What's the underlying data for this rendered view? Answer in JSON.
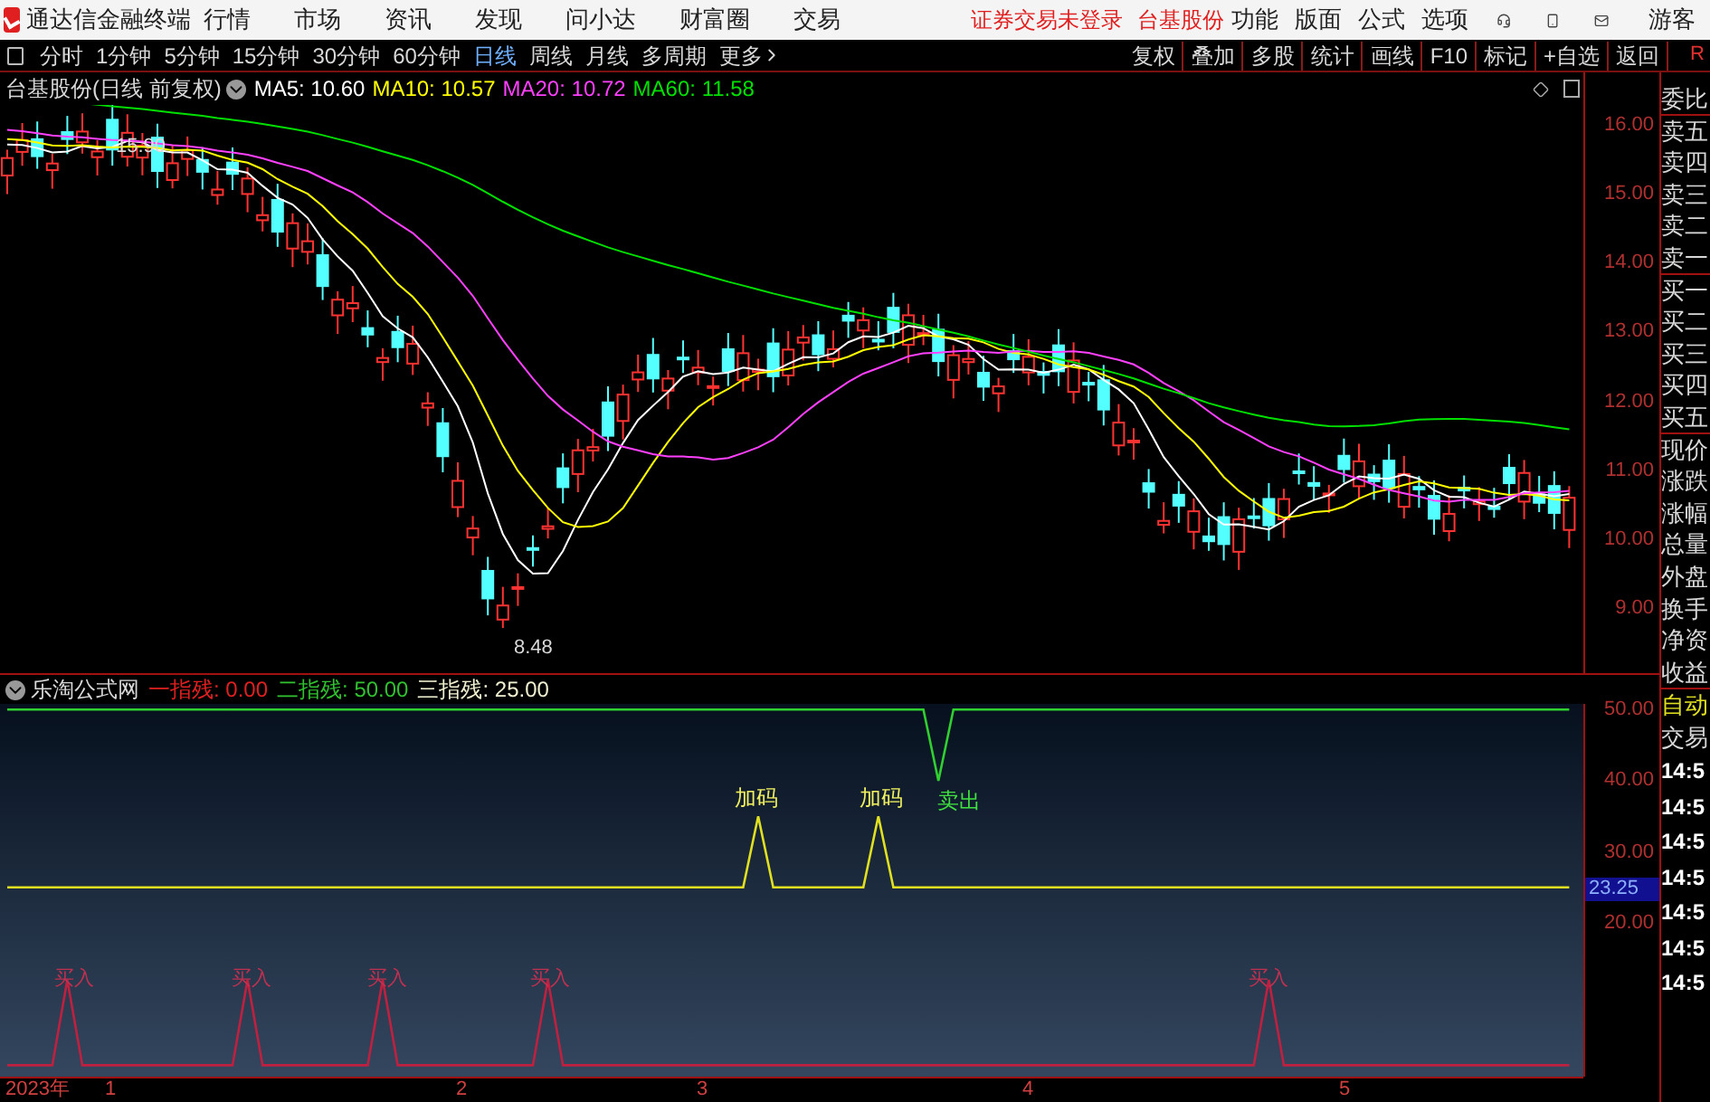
{
  "app_bar": {
    "title": "通达信金融终端",
    "menus": [
      "行情",
      "市场",
      "资讯",
      "发现",
      "问小达",
      "财富圈",
      "交易"
    ],
    "notices": [
      "证券交易未登录",
      "台基股份"
    ],
    "right_menus": [
      "功能",
      "版面",
      "公式",
      "选项"
    ],
    "user": "游客"
  },
  "period_tabs": [
    {
      "label": "分时",
      "selected": false
    },
    {
      "label": "1分钟",
      "selected": false
    },
    {
      "label": "5分钟",
      "selected": false
    },
    {
      "label": "15分钟",
      "selected": false
    },
    {
      "label": "30分钟",
      "selected": false
    },
    {
      "label": "60分钟",
      "selected": false
    },
    {
      "label": "日线",
      "selected": true
    },
    {
      "label": "周线",
      "selected": false
    },
    {
      "label": "月线",
      "selected": false
    },
    {
      "label": "多周期",
      "selected": false
    },
    {
      "label": "更多",
      "selected": false
    }
  ],
  "tools": [
    "复权",
    "叠加",
    "多股",
    "统计",
    "画线",
    "F10",
    "标记",
    "+自选",
    "返回"
  ],
  "corner_badge": "R",
  "price_chart": {
    "title": "台基股份(日线 前复权)",
    "ma": [
      {
        "label": "MA5: 10.60",
        "color": "#ffffff"
      },
      {
        "label": "MA10: 10.57",
        "color": "#ffff00"
      },
      {
        "label": "MA20: 10.72",
        "color": "#ff40ff"
      },
      {
        "label": "MA60: 11.58",
        "color": "#00e000"
      }
    ],
    "high_label": "15.90",
    "low_label": "8.48",
    "yticks": [
      "16.00",
      "15.00",
      "14.00",
      "13.00",
      "12.00",
      "11.00",
      "10.00",
      "9.00"
    ]
  },
  "indicator": {
    "name": "乐淘公式网",
    "values": [
      {
        "label": "一指残: 0.00",
        "color": "#e02020"
      },
      {
        "label": "二指残: 50.00",
        "color": "#30c030"
      },
      {
        "label": "三指残: 25.00",
        "color": "#f0f0d0"
      }
    ],
    "signals": [
      {
        "label": "加码",
        "kind": "add"
      },
      {
        "label": "加码",
        "kind": "add"
      },
      {
        "label": "卖出",
        "kind": "sell"
      },
      {
        "label": "买入",
        "kind": "buy"
      },
      {
        "label": "买入",
        "kind": "buy"
      },
      {
        "label": "买入",
        "kind": "buy"
      },
      {
        "label": "买入",
        "kind": "buy"
      },
      {
        "label": "买入",
        "kind": "buy"
      }
    ],
    "current": "23.25",
    "chart_data": {
      "type": "line",
      "ylim": [
        -1.6,
        50.8
      ],
      "yticks": [
        {
          "value": 50,
          "label": "50.00"
        },
        {
          "value": 40,
          "label": "40.00"
        },
        {
          "value": 30,
          "label": "30.00"
        },
        {
          "value": 20,
          "label": "20.00"
        }
      ],
      "series": [
        {
          "color": "#30d030",
          "values": [
            50,
            50,
            50,
            50,
            50,
            50,
            50,
            50,
            50,
            50,
            50,
            50,
            50,
            50,
            50,
            50,
            50,
            50,
            50,
            50,
            50,
            50,
            50,
            50,
            50,
            50,
            50,
            50,
            50,
            50,
            50,
            50,
            50,
            50,
            50,
            50,
            50,
            50,
            50,
            50,
            50,
            50,
            50,
            50,
            50,
            50,
            50,
            50,
            50,
            50,
            50,
            50,
            50,
            50,
            50,
            50,
            50,
            50,
            50,
            50,
            50,
            50,
            40,
            50,
            50,
            50,
            50,
            50,
            50,
            50,
            50,
            50,
            50,
            50,
            50,
            50,
            50,
            50,
            50,
            50,
            50,
            50,
            50,
            50,
            50,
            50,
            50,
            50,
            50,
            50,
            50,
            50,
            50,
            50,
            50,
            50,
            50,
            50,
            50,
            50,
            50,
            50,
            50,
            50,
            50
          ]
        },
        {
          "color": "#e0e020",
          "values": [
            25,
            25,
            25,
            25,
            25,
            25,
            25,
            25,
            25,
            25,
            25,
            25,
            25,
            25,
            25,
            25,
            25,
            25,
            25,
            25,
            25,
            25,
            25,
            25,
            25,
            25,
            25,
            25,
            25,
            25,
            25,
            25,
            25,
            25,
            25,
            25,
            25,
            25,
            25,
            25,
            25,
            25,
            25,
            25,
            25,
            25,
            25,
            25,
            25,
            25,
            35,
            25,
            25,
            25,
            25,
            25,
            25,
            25,
            35,
            25,
            25,
            25,
            25,
            25,
            25,
            25,
            25,
            25,
            25,
            25,
            25,
            25,
            25,
            25,
            25,
            25,
            25,
            25,
            25,
            25,
            25,
            25,
            25,
            25,
            25,
            25,
            25,
            25,
            25,
            25,
            25,
            25,
            25,
            25,
            25,
            25,
            25,
            25,
            25,
            25,
            25,
            25,
            25,
            25,
            25
          ]
        },
        {
          "color": "#c02040",
          "values": [
            0,
            0,
            0,
            0,
            12,
            0,
            0,
            0,
            0,
            0,
            0,
            0,
            0,
            0,
            0,
            0,
            12,
            0,
            0,
            0,
            0,
            0,
            0,
            0,
            0,
            12,
            0,
            0,
            0,
            0,
            0,
            0,
            0,
            0,
            0,
            0,
            12,
            0,
            0,
            0,
            0,
            0,
            0,
            0,
            0,
            0,
            0,
            0,
            0,
            0,
            0,
            0,
            0,
            0,
            0,
            0,
            0,
            0,
            0,
            0,
            0,
            0,
            0,
            0,
            0,
            0,
            0,
            0,
            0,
            0,
            0,
            0,
            0,
            0,
            0,
            0,
            0,
            0,
            0,
            0,
            0,
            0,
            0,
            0,
            12,
            0,
            0,
            0,
            0,
            0,
            0,
            0,
            0,
            0,
            0,
            0,
            0,
            0,
            0,
            0,
            0,
            0,
            0,
            0,
            0
          ]
        }
      ]
    }
  },
  "quote_labels": [
    "委比",
    "卖五",
    "卖四",
    "卖三",
    "卖二",
    "卖一",
    "买一",
    "买二",
    "买三",
    "买四",
    "买五",
    "现价",
    "涨跌",
    "涨幅",
    "总量",
    "外盘",
    "换手",
    "净资",
    "收益"
  ],
  "trade_labels": [
    "自动",
    "交易"
  ],
  "times": [
    "14:5",
    "14:5",
    "14:5",
    "14:5",
    "14:5",
    "14:5",
    "14:5"
  ],
  "x_axis": [
    "2023年",
    "1",
    "2",
    "3",
    "4",
    "5"
  ]
}
